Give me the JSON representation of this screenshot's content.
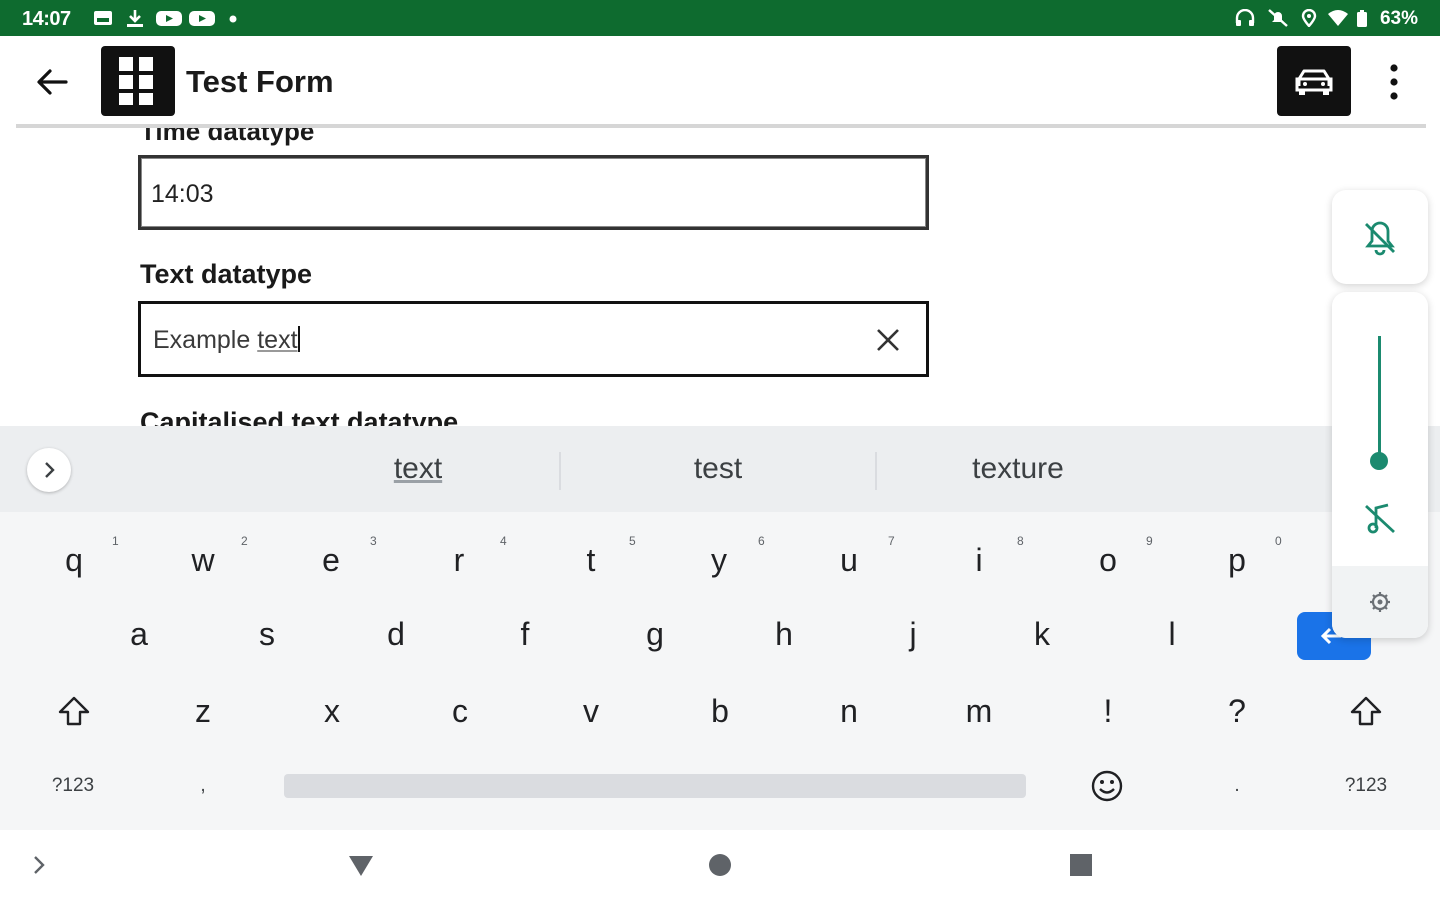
{
  "status_bar": {
    "time": "14:07",
    "battery": "63%",
    "left_icons": [
      "gallery-icon",
      "download-icon",
      "youtube-icon",
      "youtube-icon",
      "dot-icon"
    ],
    "right_icons": [
      "headset-icon",
      "bell-off-icon",
      "location-icon",
      "wifi-icon",
      "battery-icon"
    ],
    "bg_color": "#0e6b2f"
  },
  "app_bar": {
    "title": "Test Form",
    "icons": [
      "back-arrow-icon",
      "grid-logo-icon",
      "car-icon",
      "more-vert-icon"
    ]
  },
  "form": {
    "cut_off_label": "Time datatype",
    "time_field": {
      "value": "14:03"
    },
    "text_label": "Text datatype",
    "text_field": {
      "value_prefix": "Example ",
      "value_underlined": "text"
    },
    "next_label": "Capitalised text datatype"
  },
  "keyboard": {
    "suggestions": [
      "text",
      "test",
      "texture"
    ],
    "row1": [
      {
        "key": "q",
        "hint": "1"
      },
      {
        "key": "w",
        "hint": "2"
      },
      {
        "key": "e",
        "hint": "3"
      },
      {
        "key": "r",
        "hint": "4"
      },
      {
        "key": "t",
        "hint": "5"
      },
      {
        "key": "y",
        "hint": "6"
      },
      {
        "key": "u",
        "hint": "7"
      },
      {
        "key": "i",
        "hint": "8"
      },
      {
        "key": "o",
        "hint": "9"
      },
      {
        "key": "p",
        "hint": "0"
      }
    ],
    "row2": [
      "a",
      "s",
      "d",
      "f",
      "g",
      "h",
      "j",
      "k",
      "l"
    ],
    "row3": [
      "z",
      "x",
      "c",
      "v",
      "b",
      "n",
      "m",
      "!",
      "?"
    ],
    "row4": {
      "symbols_left": "?123",
      "comma": ",",
      "period": ".",
      "symbols_right": "?123"
    },
    "accent_color": "#1a73e8"
  },
  "volume_panel": {
    "level": 0,
    "accent_color": "#1b8a6f",
    "icons": [
      "ringer-off-icon",
      "media-muted-icon",
      "settings-icon"
    ]
  },
  "nav_bar": {
    "icons": [
      "chevron-right-icon",
      "back-triangle-icon",
      "home-circle-icon",
      "recents-square-icon"
    ]
  }
}
